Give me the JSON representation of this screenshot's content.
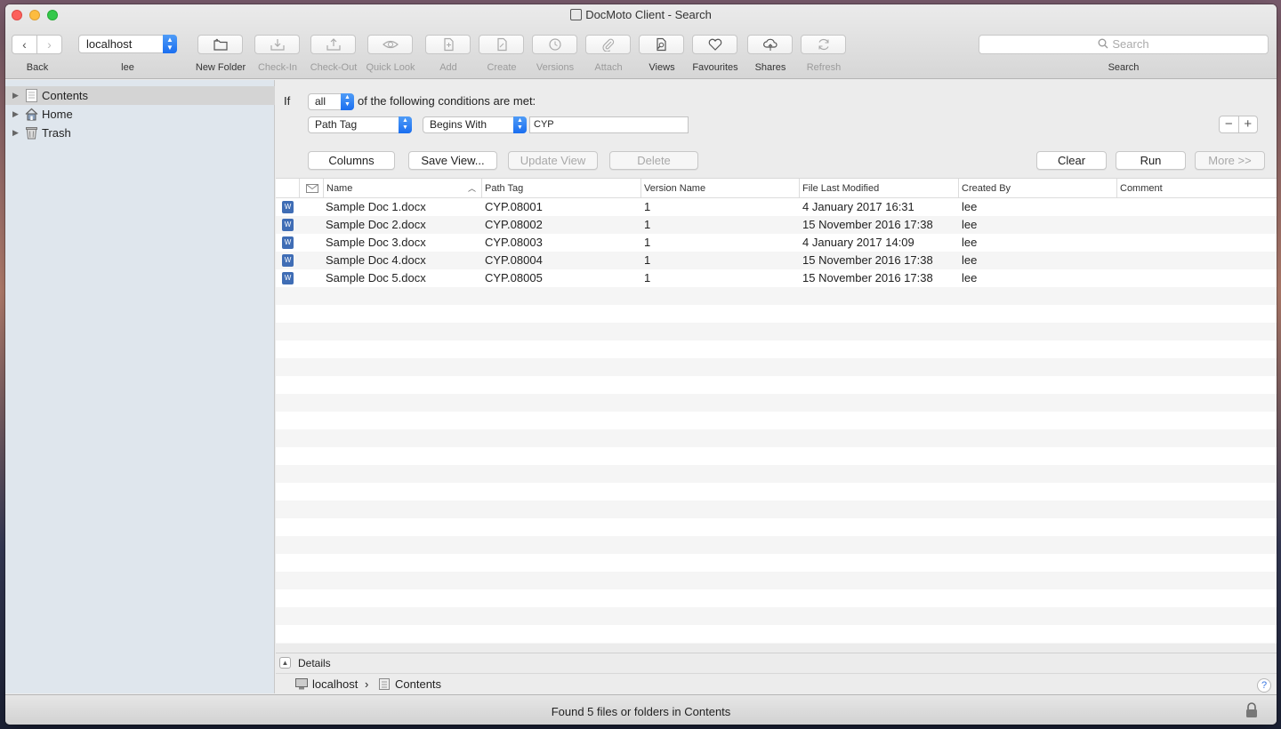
{
  "window": {
    "title": "DocMoto Client - Search"
  },
  "toolbar": {
    "back_label": "Back",
    "server": "localhost",
    "user": "lee",
    "buttons": [
      {
        "label": "New Folder",
        "icon": "new-folder-icon",
        "enabled": true
      },
      {
        "label": "Check-In",
        "icon": "check-in-icon",
        "enabled": false
      },
      {
        "label": "Check-Out",
        "icon": "check-out-icon",
        "enabled": false
      },
      {
        "label": "Quick Look",
        "icon": "eye-icon",
        "enabled": false
      },
      {
        "label": "Add",
        "icon": "add-doc-icon",
        "enabled": false
      },
      {
        "label": "Create",
        "icon": "create-doc-icon",
        "enabled": false
      },
      {
        "label": "Versions",
        "icon": "history-icon",
        "enabled": false
      },
      {
        "label": "Attach",
        "icon": "paperclip-icon",
        "enabled": false
      },
      {
        "label": "Views",
        "icon": "views-icon",
        "enabled": true
      },
      {
        "label": "Favourites",
        "icon": "heart-icon",
        "enabled": true
      },
      {
        "label": "Shares",
        "icon": "cloud-share-icon",
        "enabled": true
      },
      {
        "label": "Refresh",
        "icon": "refresh-icon",
        "enabled": false
      }
    ],
    "search_placeholder": "Search",
    "search_label": "Search"
  },
  "sidebar": {
    "items": [
      {
        "label": "Contents",
        "icon": "contents-icon",
        "selected": true
      },
      {
        "label": "Home",
        "icon": "home-icon",
        "selected": false
      },
      {
        "label": "Trash",
        "icon": "trash-icon",
        "selected": false
      }
    ]
  },
  "search": {
    "if_label": "If",
    "match_mode": "all",
    "conditions_text": "of the following conditions are met:",
    "condition": {
      "field": "Path Tag",
      "operator": "Begins With",
      "value": "CYP"
    },
    "minus": "−",
    "plus": "+",
    "buttons": {
      "columns": "Columns",
      "save_view": "Save View...",
      "update_view": "Update View",
      "delete": "Delete",
      "clear": "Clear",
      "run": "Run",
      "more": "More >>"
    }
  },
  "table": {
    "columns": [
      "Name",
      "Path Tag",
      "Version Name",
      "File Last Modified",
      "Created By",
      "Comment"
    ],
    "rows": [
      {
        "name": "Sample Doc 1.docx",
        "path_tag": "CYP.08001",
        "version": "1",
        "modified": "4 January 2017 16:31",
        "created_by": "lee",
        "comment": ""
      },
      {
        "name": "Sample Doc 2.docx",
        "path_tag": "CYP.08002",
        "version": "1",
        "modified": "15 November 2016 17:38",
        "created_by": "lee",
        "comment": ""
      },
      {
        "name": "Sample Doc 3.docx",
        "path_tag": "CYP.08003",
        "version": "1",
        "modified": "4 January 2017 14:09",
        "created_by": "lee",
        "comment": ""
      },
      {
        "name": "Sample Doc 4.docx",
        "path_tag": "CYP.08004",
        "version": "1",
        "modified": "15 November 2016 17:38",
        "created_by": "lee",
        "comment": ""
      },
      {
        "name": "Sample Doc 5.docx",
        "path_tag": "CYP.08005",
        "version": "1",
        "modified": "15 November 2016 17:38",
        "created_by": "lee",
        "comment": ""
      }
    ]
  },
  "details": {
    "label": "Details"
  },
  "pathbar": {
    "server": "localhost",
    "separator": "›",
    "folder": "Contents",
    "help": "?"
  },
  "status": {
    "text": "Found 5 files or folders in Contents"
  }
}
